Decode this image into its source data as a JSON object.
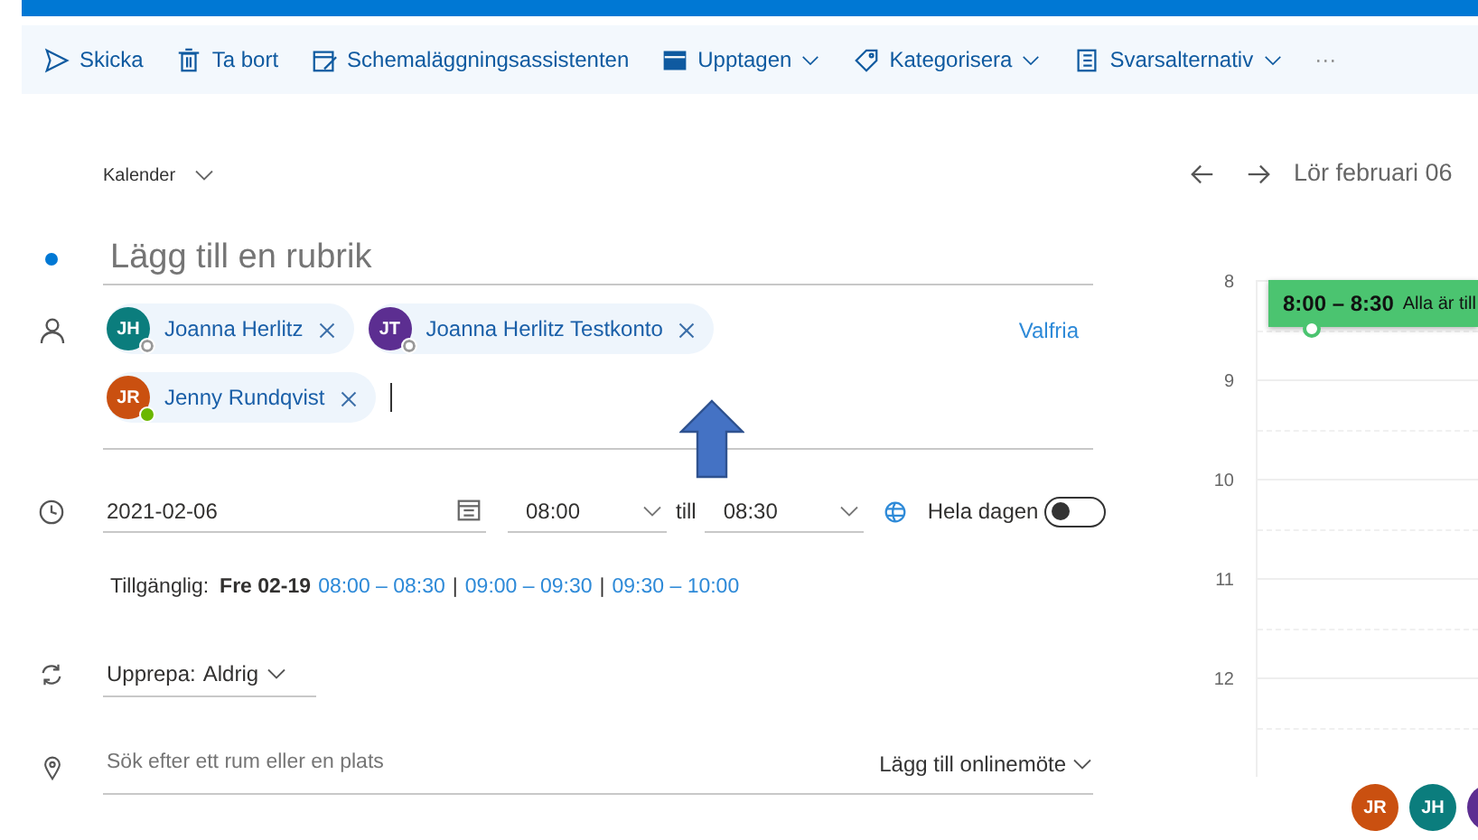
{
  "toolbar": [
    {
      "label": "Skicka",
      "kind": "send",
      "dropdown": false
    },
    {
      "label": "Ta bort",
      "kind": "delete",
      "dropdown": false
    },
    {
      "label": "Schemaläggningsassistenten",
      "kind": "schedule",
      "dropdown": false
    },
    {
      "label": "Upptagen",
      "kind": "status",
      "dropdown": true
    },
    {
      "label": "Kategorisera",
      "kind": "category",
      "dropdown": true
    },
    {
      "label": "Svarsalternativ",
      "kind": "response",
      "dropdown": true
    }
  ],
  "toolbar_more": "···",
  "calendar_picker": "Kalender",
  "title": {
    "placeholder": "Lägg till en rubrik"
  },
  "attendees": [
    {
      "initials": "JH",
      "name": "Joanna Herlitz",
      "color": "#0b7d7d",
      "available": false
    },
    {
      "initials": "JT",
      "name": "Joanna Herlitz Testkonto",
      "color": "#5c2e91",
      "available": false
    },
    {
      "initials": "JR",
      "name": "Jenny Rundqvist",
      "color": "#ca5010",
      "available": true
    }
  ],
  "optional_link": "Valfria",
  "date": "2021-02-06",
  "start": "08:00",
  "till": "till",
  "end": "08:30",
  "all_day": {
    "label": "Hela dagen",
    "on": false
  },
  "availability": {
    "label": "Tillgänglig:",
    "day": "Fre 02-19",
    "separator": "|",
    "slots": [
      "08:00 – 08:30",
      "09:00 – 09:30",
      "09:30 – 10:00"
    ]
  },
  "repeat": {
    "label": "Upprepa:",
    "value": "Aldrig"
  },
  "location": {
    "placeholder": "Sök efter ett rum eller en plats"
  },
  "online_meeting": "Lägg till onlinemöte",
  "day_view": {
    "date": "Lör februari 06",
    "hours": [
      "8",
      "9",
      "10",
      "11",
      "12"
    ],
    "event": {
      "time": "8:00 – 8:30",
      "text": "Alla är till"
    },
    "avatars": [
      {
        "initials": "JR",
        "color": "#ca5010"
      },
      {
        "initials": "JH",
        "color": "#0b7d7d"
      },
      {
        "color": "#5c2e91"
      }
    ]
  }
}
